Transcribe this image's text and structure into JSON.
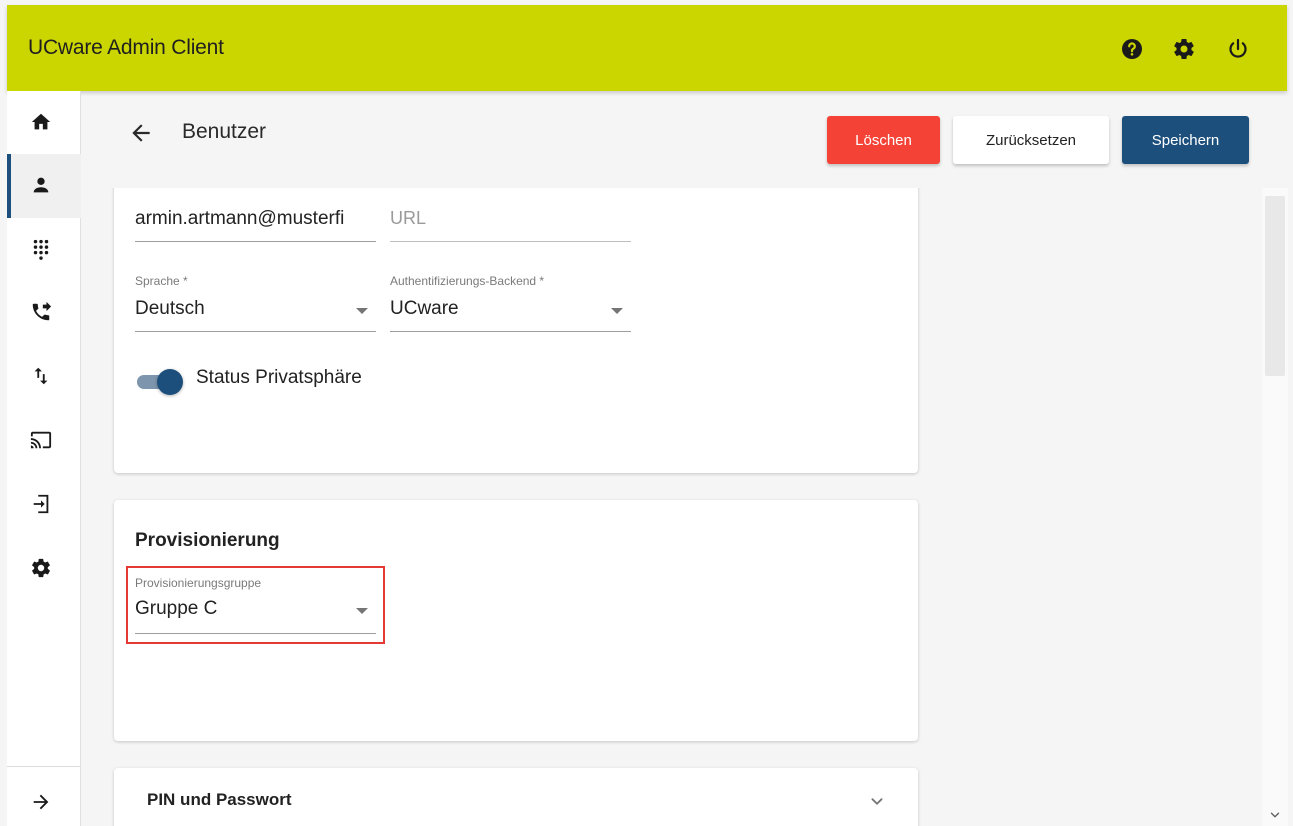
{
  "app": {
    "title": "UCware Admin Client"
  },
  "topbar": {
    "icons": [
      {
        "name": "help-icon"
      },
      {
        "name": "settings-icon"
      },
      {
        "name": "power-icon"
      }
    ]
  },
  "sidebar": {
    "items": [
      {
        "icon": "home-icon",
        "active": false
      },
      {
        "icon": "person-icon",
        "active": true
      },
      {
        "icon": "dialpad-icon",
        "active": false
      },
      {
        "icon": "phone-forwarded-icon",
        "active": false
      },
      {
        "icon": "swap-vert-icon",
        "active": false
      },
      {
        "icon": "cast-icon",
        "active": false
      },
      {
        "icon": "login-icon",
        "active": false
      },
      {
        "icon": "gear-icon",
        "active": false
      }
    ],
    "expand_icon": "arrow-forward-icon"
  },
  "header": {
    "title": "Benutzer",
    "delete_label": "Löschen",
    "reset_label": "Zurücksetzen",
    "save_label": "Speichern"
  },
  "colors": {
    "topbar": "#cbd500",
    "primary": "#1d4f7c",
    "danger": "#f44336",
    "highlight": "#e53935"
  },
  "form": {
    "email_value": "armin.artmann@musterfi",
    "url_placeholder": "URL",
    "language_label": "Sprache *",
    "language_value": "Deutsch",
    "auth_label": "Authentifizierungs-Backend *",
    "auth_value": "UCware",
    "privacy_label": "Status Privatsphäre",
    "privacy_enabled": true
  },
  "provisioning": {
    "title": "Provisionierung",
    "group_label": "Provisionierungsgruppe",
    "group_value": "Gruppe C"
  },
  "pin_section": {
    "title": "PIN und Passwort"
  }
}
